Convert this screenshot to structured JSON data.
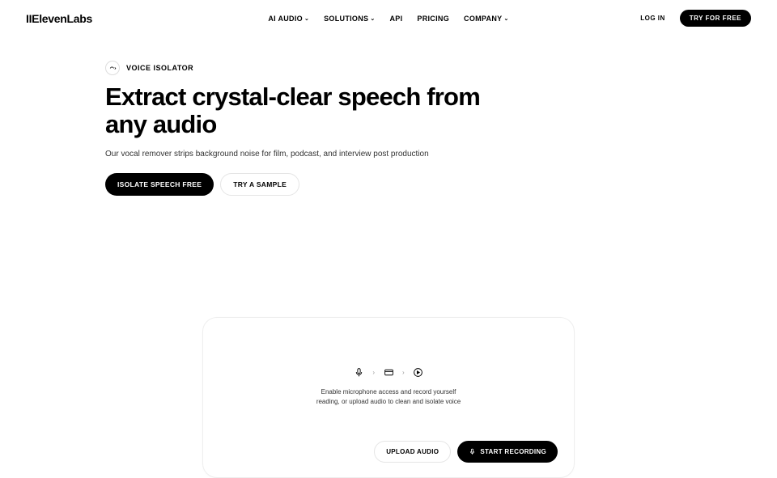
{
  "header": {
    "logo": "IIElevenLabs",
    "nav": {
      "ai_audio": "AI AUDIO",
      "solutions": "SOLUTIONS",
      "api": "API",
      "pricing": "PRICING",
      "company": "COMPANY"
    },
    "login": "LOG IN",
    "try_free": "TRY FOR FREE"
  },
  "hero": {
    "badge": "VOICE ISOLATOR",
    "title": "Extract crystal-clear speech from any audio",
    "subtitle": "Our vocal remover strips background noise for film, podcast, and interview post production",
    "cta_primary": "ISOLATE SPEECH FREE",
    "cta_secondary": "TRY A SAMPLE"
  },
  "card": {
    "text": "Enable microphone access and record yourself reading, or upload audio to clean and isolate voice",
    "upload": "UPLOAD AUDIO",
    "record": "START RECORDING"
  }
}
